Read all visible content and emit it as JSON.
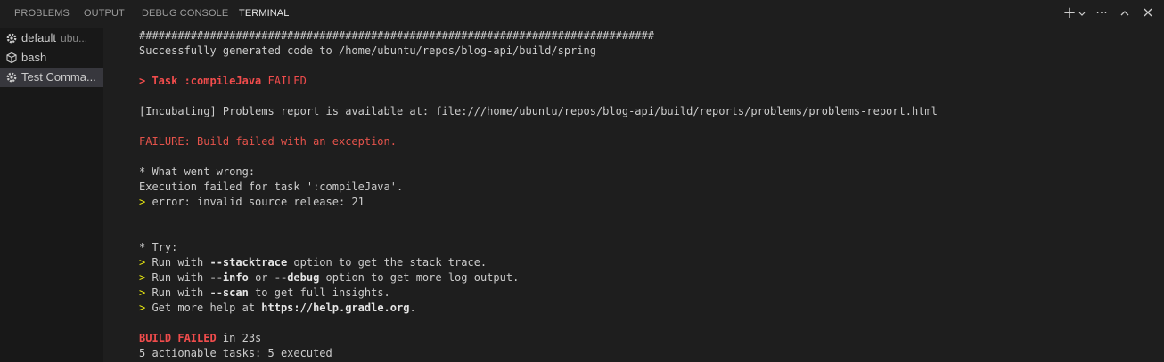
{
  "tabs": [
    {
      "label": "PROBLEMS"
    },
    {
      "label": "OUTPUT"
    },
    {
      "label": "DEBUG CONSOLE"
    },
    {
      "label": "TERMINAL",
      "active": true
    }
  ],
  "toolbar_icons": [
    "plus-icon",
    "chevron-down-icon",
    "more-icon",
    "chevron-up-icon",
    "close-icon"
  ],
  "sidebar": {
    "items": [
      {
        "label": "default",
        "description": "ubu...",
        "icon": "tools-icon"
      },
      {
        "label": "bash",
        "icon": "cube-icon"
      },
      {
        "label": "Test Comma...",
        "icon": "tools-icon",
        "selected": true
      }
    ]
  },
  "terminal": {
    "hash_line": "################################################################################",
    "generated": "Successfully generated code to /home/ubuntu/repos/blog-api/build/spring",
    "task_prefix": "> Task :compileJava ",
    "task_status": "FAILED",
    "incubating": "[Incubating] Problems report is available at: file:///home/ubuntu/repos/blog-api/build/reports/problems/problems-report.html",
    "failure": "FAILURE: Build failed with an exception.",
    "what_went_wrong": "* What went wrong:",
    "execution_failed": "Execution failed for task ':compileJava'.",
    "error_prefix": "> ",
    "error_text": "error: invalid source release: 21",
    "try": "* Try:",
    "prompt": "> ",
    "run_with": "Run with ",
    "stacktrace_flag": "--stacktrace",
    "stacktrace_rest": " option to get the stack trace.",
    "info_flag": "--info",
    "or_text": " or ",
    "debug_flag": "--debug",
    "debug_rest": " option to get more log output.",
    "scan_flag": "--scan",
    "scan_rest": " to get full insights.",
    "help_text": "Get more help at ",
    "help_url": "https://help.gradle.org",
    "help_end": ".",
    "build_failed": "BUILD FAILED",
    "build_time": " in 23s",
    "actionable": "5 actionable tasks: 5 executed"
  }
}
